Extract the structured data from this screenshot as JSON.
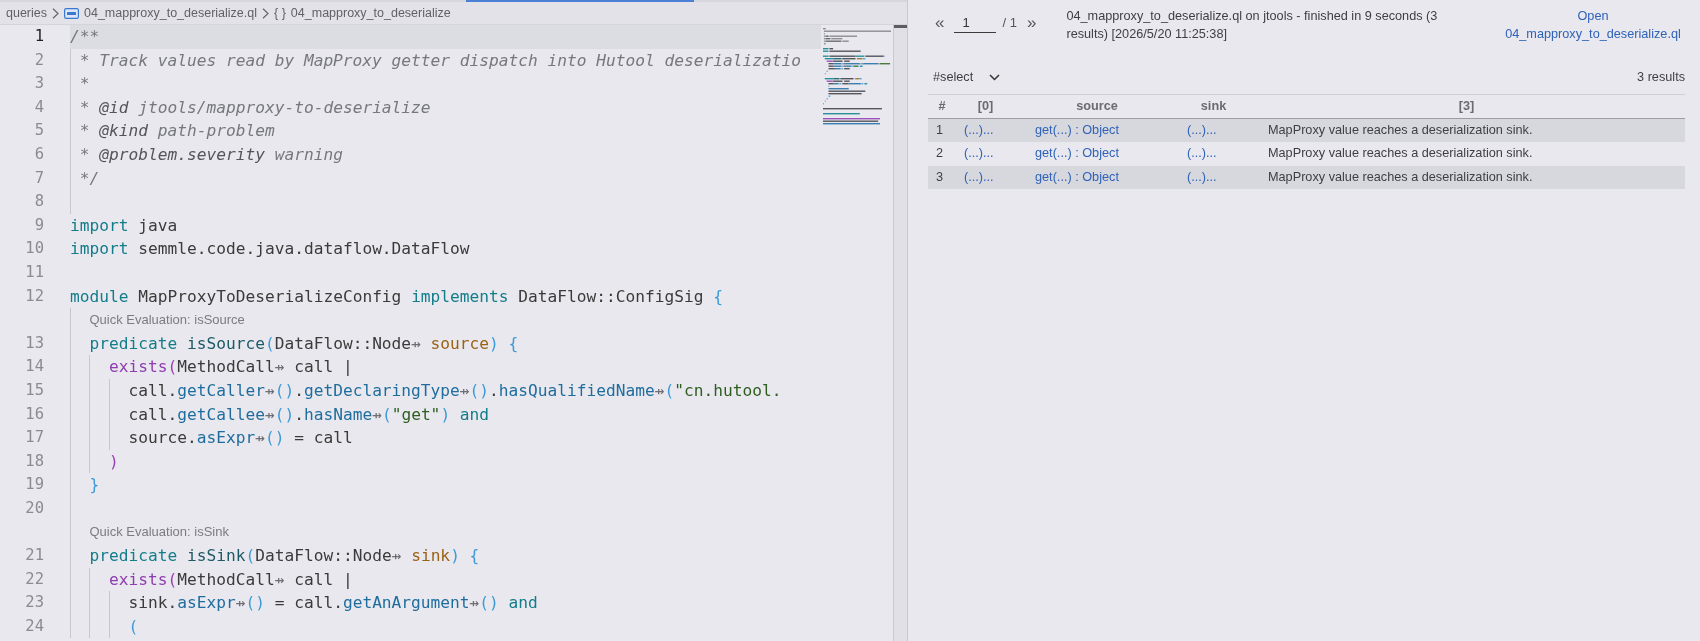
{
  "breadcrumbs": [
    {
      "kind": "folder",
      "label": "queries"
    },
    {
      "kind": "file",
      "label": "04_mapproxy_to_deserialize.ql"
    },
    {
      "kind": "symbol",
      "glyph": "{ }",
      "label": "04_mapproxy_to_deserialize"
    }
  ],
  "editor": {
    "lines": [
      {
        "kind": "code",
        "number": "1",
        "current": true,
        "tokens": [
          {
            "kind": "comment",
            "text": "/**"
          }
        ]
      },
      {
        "kind": "code",
        "number": "2",
        "current": false,
        "tokens": [
          {
            "kind": "comment",
            "text": " * Track values read by MapProxy getter dispatch into Hutool deserializatio"
          }
        ]
      },
      {
        "kind": "code",
        "number": "3",
        "current": false,
        "tokens": [
          {
            "kind": "comment",
            "text": " *"
          }
        ]
      },
      {
        "kind": "code",
        "number": "4",
        "current": false,
        "tokens": [
          {
            "kind": "comment",
            "text": " * "
          },
          {
            "kind": "doctag",
            "text": "@id"
          },
          {
            "kind": "comment",
            "text": " jtools/mapproxy-to-deserialize"
          }
        ]
      },
      {
        "kind": "code",
        "number": "5",
        "current": false,
        "tokens": [
          {
            "kind": "comment",
            "text": " * "
          },
          {
            "kind": "doctag",
            "text": "@kind"
          },
          {
            "kind": "comment",
            "text": " path-problem"
          }
        ]
      },
      {
        "kind": "code",
        "number": "6",
        "current": false,
        "tokens": [
          {
            "kind": "comment",
            "text": " * "
          },
          {
            "kind": "doctag",
            "text": "@problem.severity"
          },
          {
            "kind": "comment",
            "text": " warning"
          }
        ]
      },
      {
        "kind": "code",
        "number": "7",
        "current": false,
        "tokens": [
          {
            "kind": "comment",
            "text": " */"
          }
        ]
      },
      {
        "kind": "code",
        "number": "8",
        "current": false
      },
      {
        "kind": "code",
        "number": "9",
        "current": false,
        "tokens": [
          {
            "kind": "keyword",
            "text": "import"
          },
          {
            "kind": "plain",
            "text": " java"
          }
        ]
      },
      {
        "kind": "code",
        "number": "10",
        "current": false,
        "tokens": [
          {
            "kind": "keyword",
            "text": "import"
          },
          {
            "kind": "plain",
            "text": " semmle.code.java.dataflow.DataFlow"
          }
        ]
      },
      {
        "kind": "code",
        "number": "11",
        "current": false
      },
      {
        "kind": "code",
        "number": "12",
        "current": false,
        "tokens": [
          {
            "kind": "keyword",
            "text": "module"
          },
          {
            "kind": "plain",
            "text": " MapProxyToDeserializeConfig "
          },
          {
            "kind": "keyword",
            "text": "implements"
          },
          {
            "kind": "plain",
            "text": " DataFlow::ConfigSig "
          },
          {
            "kind": "bracket",
            "text": "{"
          }
        ]
      },
      {
        "kind": "codelens",
        "current": false,
        "text": "Quick Evaluation: isSource"
      },
      {
        "kind": "code",
        "number": "13",
        "current": false,
        "tokens": [
          {
            "kind": "keyword",
            "text": "  predicate "
          },
          {
            "kind": "definition",
            "text": "isSource"
          },
          {
            "kind": "bracket",
            "text": "("
          },
          {
            "kind": "plain",
            "text": "DataFlow::Node"
          },
          {
            "kind": "hint",
            "text": "⇸"
          },
          {
            "kind": "param",
            "text": " source"
          },
          {
            "kind": "bracket",
            "text": ") {"
          }
        ]
      },
      {
        "kind": "code",
        "number": "14",
        "current": false,
        "tokens": [
          {
            "kind": "builtin",
            "text": "    exists"
          },
          {
            "kind": "bracket2",
            "text": "("
          },
          {
            "kind": "plain",
            "text": "MethodCall"
          },
          {
            "kind": "hint",
            "text": "⇸"
          },
          {
            "kind": "plain",
            "text": " call |"
          }
        ]
      },
      {
        "kind": "code",
        "number": "15",
        "current": false,
        "tokens": [
          {
            "kind": "plain",
            "text": "      call."
          },
          {
            "kind": "method",
            "text": "getCaller"
          },
          {
            "kind": "hint",
            "text": "⇸"
          },
          {
            "kind": "bracket",
            "text": "()"
          },
          {
            "kind": "plain",
            "text": "."
          },
          {
            "kind": "method",
            "text": "getDeclaringType"
          },
          {
            "kind": "hint",
            "text": "⇸"
          },
          {
            "kind": "bracket",
            "text": "()"
          },
          {
            "kind": "plain",
            "text": "."
          },
          {
            "kind": "method",
            "text": "hasQualifiedName"
          },
          {
            "kind": "hint",
            "text": "⇸"
          },
          {
            "kind": "bracket",
            "text": "("
          },
          {
            "kind": "string",
            "text": "\"cn.hutool."
          }
        ]
      },
      {
        "kind": "code",
        "number": "16",
        "current": false,
        "tokens": [
          {
            "kind": "plain",
            "text": "      call."
          },
          {
            "kind": "method",
            "text": "getCallee"
          },
          {
            "kind": "hint",
            "text": "⇸"
          },
          {
            "kind": "bracket",
            "text": "()"
          },
          {
            "kind": "plain",
            "text": "."
          },
          {
            "kind": "method",
            "text": "hasName"
          },
          {
            "kind": "hint",
            "text": "⇸"
          },
          {
            "kind": "bracket",
            "text": "("
          },
          {
            "kind": "string",
            "text": "\"get\""
          },
          {
            "kind": "bracket",
            "text": ")"
          },
          {
            "kind": "keyword",
            "text": " and"
          }
        ]
      },
      {
        "kind": "code",
        "number": "17",
        "current": false,
        "tokens": [
          {
            "kind": "plain",
            "text": "      source."
          },
          {
            "kind": "method",
            "text": "asExpr"
          },
          {
            "kind": "hint",
            "text": "⇸"
          },
          {
            "kind": "bracket",
            "text": "()"
          },
          {
            "kind": "plain",
            "text": " = call"
          }
        ]
      },
      {
        "kind": "code",
        "number": "18",
        "current": false,
        "tokens": [
          {
            "kind": "bracket2",
            "text": "    )"
          }
        ]
      },
      {
        "kind": "code",
        "number": "19",
        "current": false,
        "tokens": [
          {
            "kind": "bracket",
            "text": "  }"
          }
        ]
      },
      {
        "kind": "code",
        "number": "20",
        "current": false
      },
      {
        "kind": "codelens",
        "current": false,
        "text": "Quick Evaluation: isSink"
      },
      {
        "kind": "code",
        "number": "21",
        "current": false,
        "tokens": [
          {
            "kind": "keyword",
            "text": "  predicate "
          },
          {
            "kind": "definition",
            "text": "isSink"
          },
          {
            "kind": "bracket",
            "text": "("
          },
          {
            "kind": "plain",
            "text": "DataFlow::Node"
          },
          {
            "kind": "hint",
            "text": "⇸"
          },
          {
            "kind": "param",
            "text": " sink"
          },
          {
            "kind": "bracket",
            "text": ") {"
          }
        ]
      },
      {
        "kind": "code",
        "number": "22",
        "current": false,
        "tokens": [
          {
            "kind": "builtin",
            "text": "    exists"
          },
          {
            "kind": "bracket2",
            "text": "("
          },
          {
            "kind": "plain",
            "text": "MethodCall"
          },
          {
            "kind": "hint",
            "text": "⇸"
          },
          {
            "kind": "plain",
            "text": " call |"
          }
        ]
      },
      {
        "kind": "code",
        "number": "23",
        "current": false,
        "tokens": [
          {
            "kind": "plain",
            "text": "      sink."
          },
          {
            "kind": "method",
            "text": "asExpr"
          },
          {
            "kind": "hint",
            "text": "⇸"
          },
          {
            "kind": "bracket",
            "text": "()"
          },
          {
            "kind": "plain",
            "text": " = call."
          },
          {
            "kind": "method",
            "text": "getAnArgument"
          },
          {
            "kind": "hint",
            "text": "⇸"
          },
          {
            "kind": "bracket",
            "text": "()"
          },
          {
            "kind": "keyword",
            "text": " and"
          }
        ]
      },
      {
        "kind": "code",
        "number": "24",
        "current": false,
        "tokens": [
          {
            "kind": "bracket",
            "text": "      ("
          }
        ]
      }
    ]
  },
  "results": {
    "pager": {
      "previous": "«",
      "page": "1",
      "total": "/ 1",
      "next": "»"
    },
    "title": "04_mapproxy_to_deserialize.ql on jtools - finished in 9 seconds (3 results) [2026/5/20 11:25:38]",
    "open_link": "Open 04_mapproxy_to_deserialize.ql",
    "result_set": "#select",
    "count": "3 results",
    "table": {
      "columns": [
        {
          "label": "#",
          "kind": "index"
        },
        {
          "label": "[0]",
          "kind": "link"
        },
        {
          "label": "source",
          "kind": "link"
        },
        {
          "label": "sink",
          "kind": "link"
        },
        {
          "label": "[3]",
          "kind": "text"
        }
      ],
      "rows": [
        [
          "1",
          "(...)...",
          "get(...) : Object",
          "(...)...",
          "MapProxy value reaches a deserialization sink."
        ],
        [
          "2",
          "(...)...",
          "get(...) : Object",
          "(...)...",
          "MapProxy value reaches a deserialization sink."
        ],
        [
          "3",
          "(...)...",
          "get(...) : Object",
          "(...)...",
          "MapProxy value reaches a deserialization sink."
        ]
      ]
    }
  }
}
